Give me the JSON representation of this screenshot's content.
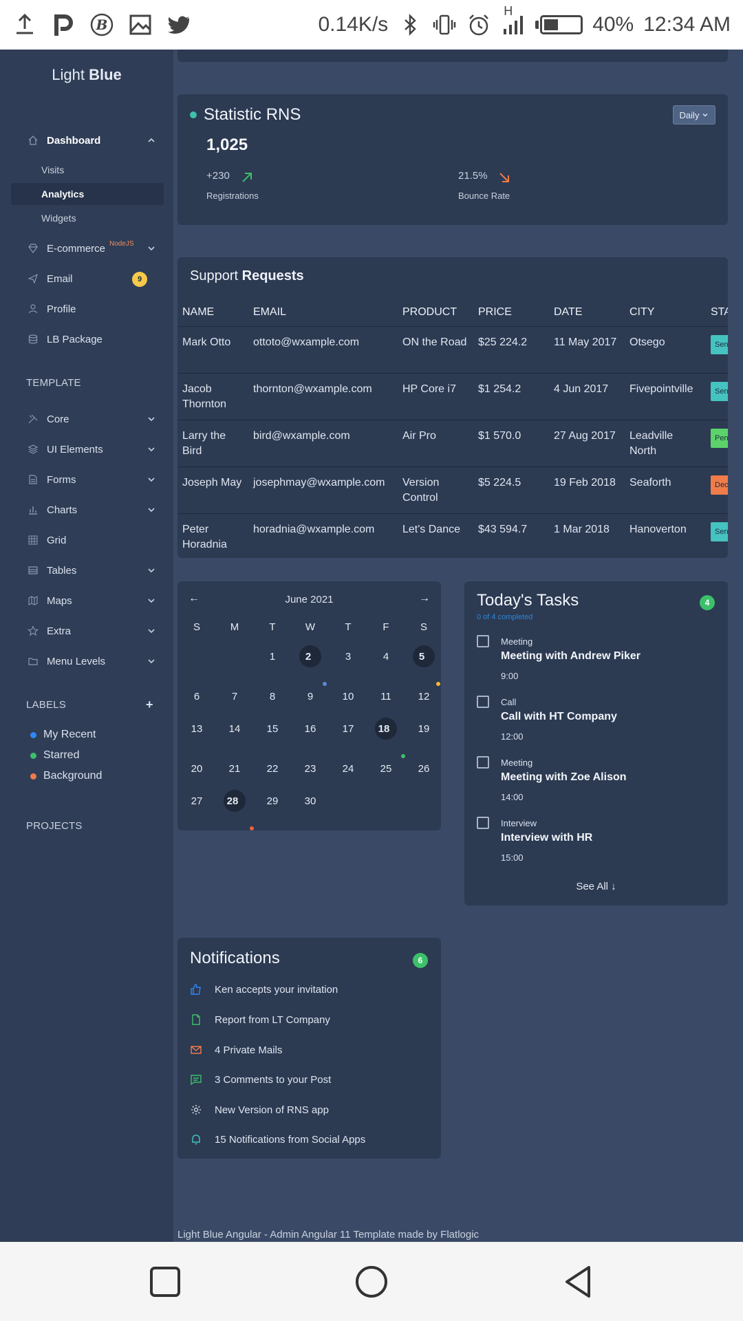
{
  "status_bar": {
    "net_speed": "0.14K/s",
    "signal_type": "H",
    "battery": "40%",
    "battery_level": 0.4,
    "time": "12:34 AM"
  },
  "sidebar": {
    "brand_light": "Light",
    "brand_bold": "Blue",
    "dashboard": "Dashboard",
    "dashboard_sub": [
      "Visits",
      "Analytics",
      "Widgets"
    ],
    "ecommerce": "E-commerce",
    "ecommerce_tag": "NodeJS",
    "email": "Email",
    "email_badge": "9",
    "profile": "Profile",
    "lb_package": "LB Package",
    "template_title": "TEMPLATE",
    "template_items": [
      "Core",
      "UI Elements",
      "Forms",
      "Charts",
      "Grid",
      "Tables",
      "Maps",
      "Extra",
      "Menu Levels"
    ],
    "labels_title": "LABELS",
    "labels": [
      {
        "name": "My Recent",
        "color": "#2f86f6"
      },
      {
        "name": "Starred",
        "color": "#3cc06a"
      },
      {
        "name": "Background",
        "color": "#f07c4a"
      }
    ],
    "projects_title": "PROJECTS"
  },
  "stat": {
    "title_light": "Statistic",
    "title_bold": "RNS",
    "value": "1,025",
    "registrations_value": "+230",
    "registrations_label": "Registrations",
    "bounce_value": "21.5%",
    "bounce_label": "Bounce Rate",
    "period": "Daily"
  },
  "support": {
    "title_light": "Support",
    "title_bold": "Requests",
    "columns": [
      "NAME",
      "EMAIL",
      "PRODUCT",
      "PRICE",
      "DATE",
      "CITY",
      "STATUS"
    ],
    "rows": [
      {
        "name": "Mark Otto",
        "email": "ottoto@wxample.com",
        "product": "ON the Road",
        "price": "$25 224.2",
        "date": "11 May 2017",
        "city": "Otsego",
        "status": "Sent",
        "status_color": "#45c3c0"
      },
      {
        "name": "Jacob Thornton",
        "email": "thornton@wxample.com",
        "product": "HP Core i7",
        "price": "$1 254.2",
        "date": "4 Jun 2017",
        "city": "Fivepointville",
        "status": "Sent",
        "status_color": "#45c3c0"
      },
      {
        "name": "Larry the Bird",
        "email": "bird@wxample.com",
        "product": "Air Pro",
        "price": "$1 570.0",
        "date": "27 Aug 2017",
        "city": "Leadville North",
        "status": "Pending",
        "status_color": "#5bd36a"
      },
      {
        "name": "Joseph May",
        "email": "josephmay@wxample.com",
        "product": "Version Control",
        "price": "$5 224.5",
        "date": "19 Feb 2018",
        "city": "Seaforth",
        "status": "Declined",
        "status_color": "#f07c4a"
      },
      {
        "name": "Peter Horadnia",
        "email": "horadnia@wxample.com",
        "product": "Let's Dance",
        "price": "$43 594.7",
        "date": "1 Mar 2018",
        "city": "Hanoverton",
        "status": "Sent",
        "status_color": "#45c3c0"
      }
    ]
  },
  "calendar": {
    "month": "June 2021",
    "prev": "←",
    "next": "→",
    "weekdays": [
      "S",
      "M",
      "T",
      "W",
      "T",
      "F",
      "S"
    ],
    "weeks": [
      [
        "",
        "",
        "1",
        "2",
        "3",
        "4",
        "5"
      ],
      [
        "6",
        "7",
        "8",
        "9",
        "10",
        "11",
        "12"
      ],
      [
        "13",
        "14",
        "15",
        "16",
        "17",
        "18",
        "19"
      ],
      [
        "20",
        "21",
        "22",
        "23",
        "24",
        "25",
        "26"
      ],
      [
        "27",
        "28",
        "29",
        "30",
        "",
        "",
        ""
      ]
    ],
    "highlighted": [
      "2",
      "5",
      "18",
      "28"
    ],
    "event_dots": {
      "2": "#5a8ad6",
      "5": "#f7b733",
      "18": "#3cc06a",
      "28": "#f0603a"
    }
  },
  "tasks": {
    "title": "Today's Tasks",
    "subtitle": "0 of 4 completed",
    "count": "4",
    "items": [
      {
        "category": "Meeting",
        "name": "Meeting with Andrew Piker",
        "time": "9:00"
      },
      {
        "category": "Call",
        "name": "Call with HT Company",
        "time": "12:00"
      },
      {
        "category": "Meeting",
        "name": "Meeting with Zoe Alison",
        "time": "14:00"
      },
      {
        "category": "Interview",
        "name": "Interview with HR",
        "time": "15:00"
      }
    ],
    "see_all": "See All ↓"
  },
  "notifications": {
    "title": "Notifications",
    "count": "6",
    "items": [
      {
        "text": "Ken accepts your invitation",
        "icon": "thumbs-up-icon",
        "color": "#2f86f6"
      },
      {
        "text": "Report from LT Company",
        "icon": "file-icon",
        "color": "#3cc06a"
      },
      {
        "text": "4 Private Mails",
        "icon": "mail-icon",
        "color": "#f07c4a"
      },
      {
        "text": "3 Comments to your Post",
        "icon": "comment-icon",
        "color": "#3cc06a"
      },
      {
        "text": "New Version of RNS app",
        "icon": "gear-icon",
        "color": "#c9d1de"
      },
      {
        "text": "15 Notifications from Social Apps",
        "icon": "bell-icon",
        "color": "#45c3c0"
      }
    ]
  },
  "footer": "Light Blue Angular - Admin Angular 11 Template made by Flatlogic"
}
